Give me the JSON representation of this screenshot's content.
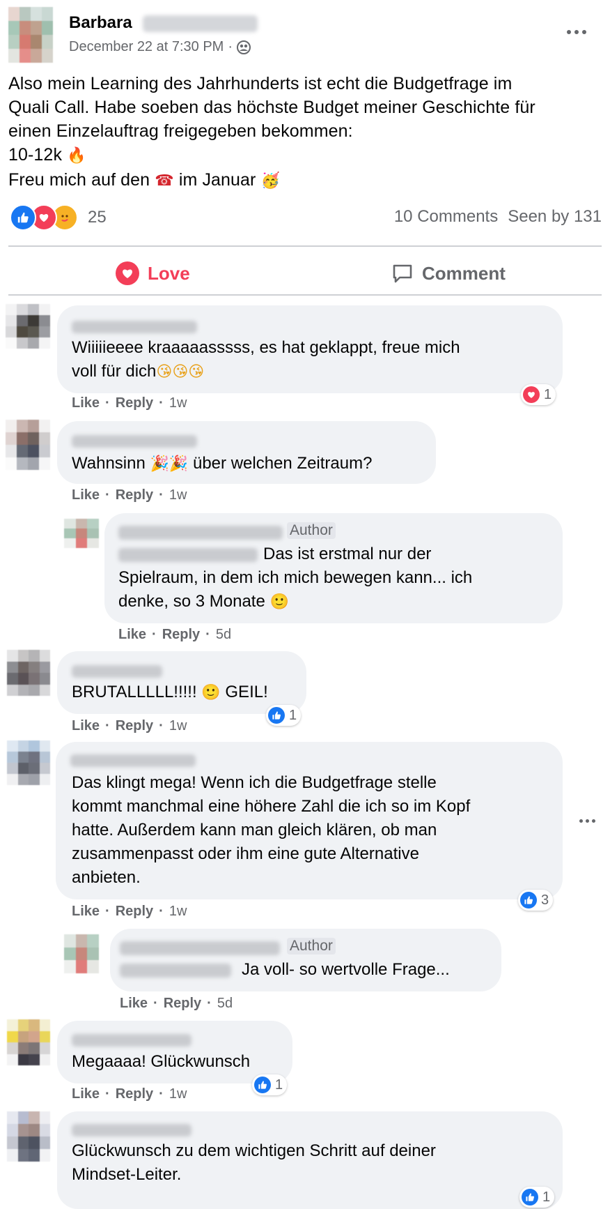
{
  "post": {
    "author_first": "Barbara",
    "timestamp": "December 22 at 7:30 PM",
    "separator": "·",
    "privacy_icon": "group-icon",
    "more_icon": "more-options-icon",
    "lines": [
      "Also mein Learning des Jahrhunderts ist echt die Budgetfrage im",
      "Quali Call. Habe soeben das höchste Budget meiner Geschichte für",
      "einen Einzelauftrag freigegeben bekommen:",
      "10-12k",
      "Freu mich auf den",
      "im Januar"
    ],
    "emoji_fire": "🔥",
    "emoji_phone": "☎",
    "emoji_party": "🥳",
    "reaction_count": "25",
    "comments_count": "10 Comments",
    "seen_by": "Seen by 131"
  },
  "actions": {
    "love_label": "Love",
    "comment_label": "Comment"
  },
  "common": {
    "like": "Like",
    "reply": "Reply",
    "dot": "·",
    "author_badge": "Author"
  },
  "comments": [
    {
      "text_lines": [
        "Wiiiiieeee kraaaaasssss, es hat geklappt, freue mich",
        "voll für dich"
      ],
      "emoji": "😘😘😘",
      "time": "1w",
      "reaction_count": "1",
      "reaction_type": "love"
    },
    {
      "text_pre": "Wahnsinn",
      "emoji": "🎉🎉",
      "text_post": "über welchen Zeitraum?",
      "time": "1w"
    },
    {
      "reply": true,
      "text_lines": [
        "Das ist erstmal nur der",
        "Spielraum, in dem ich mich bewegen kann... ich",
        "denke, so 3 Monate"
      ],
      "emoji": "🙂",
      "time": "5d"
    },
    {
      "text_pre": "BRUTALLLLL!!!!!",
      "emoji": "🙂",
      "text_post": "GEIL!",
      "time": "1w",
      "reaction_count": "1",
      "reaction_type": "like"
    },
    {
      "text_lines": [
        "Das klingt mega! Wenn ich die Budgetfrage stelle",
        "kommt manchmal eine höhere Zahl die ich so im Kopf",
        "hatte. Außerdem kann man gleich klären, ob man",
        "zusammenpasst oder ihm eine gute Alternative",
        "anbieten."
      ],
      "time": "1w",
      "reaction_count": "3",
      "reaction_type": "like"
    },
    {
      "reply": true,
      "text_lines": [
        "Ja voll- so wertvolle Frage..."
      ],
      "time": "5d"
    },
    {
      "text_lines": [
        "Megaaaa! Glückwunsch"
      ],
      "time": "1w",
      "reaction_count": "1",
      "reaction_type": "like"
    },
    {
      "text_lines": [
        "Glückwunsch zu dem wichtigen Schritt auf deiner",
        "Mindset-Leiter."
      ],
      "reaction_count": "1",
      "reaction_type": "like"
    }
  ],
  "colors": {
    "like_blue": "#1877f2",
    "love_red": "#f33e58",
    "bubble_gray": "#f0f2f5",
    "meta_gray": "#65676b"
  }
}
